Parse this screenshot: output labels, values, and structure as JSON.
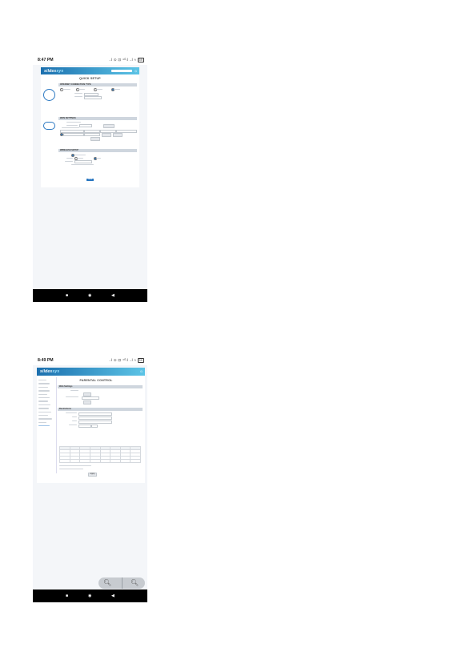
{
  "screen1": {
    "status": {
      "time": "8:47 PM",
      "icons": "..l ⊙ ⊡ ⁴ᴳ.l ..l ≈",
      "battery": "59"
    },
    "app": {
      "logo_main": "sildes",
      "logo_accent": "sys",
      "page_title": "QUICK SETUP"
    },
    "sections": [
      {
        "title": "INTERNET CONNECTION TYPE"
      },
      {
        "title": "WAN SETTINGS"
      },
      {
        "title": "WIRELESS SETUP"
      }
    ],
    "save_label": "Save"
  },
  "screen2": {
    "status": {
      "time": "8:49 PM",
      "icons": "..l ⊙ ⊡ ⁴ᴳ.l ..l ≈",
      "battery": "59"
    },
    "app": {
      "logo_main": "sildes",
      "logo_accent": "sys",
      "page_title": "PARENTAL CONTROL"
    },
    "sections": [
      {
        "title": "Web Settings"
      },
      {
        "title": "Restrictions"
      }
    ],
    "apply_label": "Apply"
  },
  "colors": {
    "brand": "#1b6fae",
    "accent": "#5cc4e6",
    "button": "#2a77c1"
  }
}
